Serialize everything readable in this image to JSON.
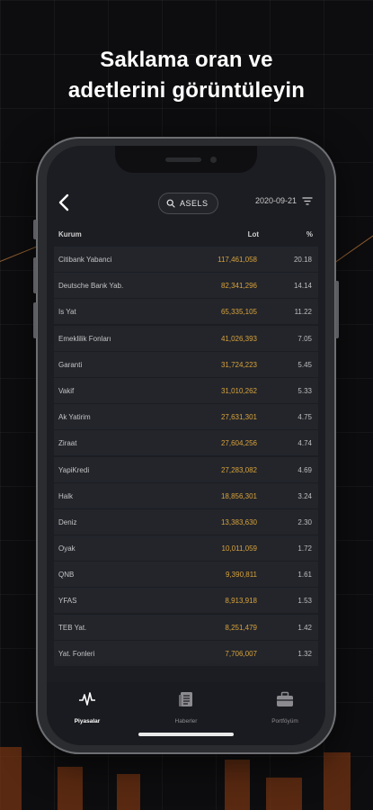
{
  "headline": {
    "line1": "Saklama oran ve",
    "line2": "adetlerini görüntüleyin"
  },
  "topbar": {
    "search_value": "ASELS",
    "date": "2020-09-21"
  },
  "table": {
    "headers": {
      "name": "Kurum",
      "lot": "Lot",
      "pct": "%"
    },
    "rows": [
      {
        "name": "Citibank Yabanci",
        "lot": "117,461,058",
        "pct": "20.18"
      },
      {
        "name": "Deutsche Bank Yab.",
        "lot": "82,341,296",
        "pct": "14.14"
      },
      {
        "name": "Is Yat",
        "lot": "65,335,105",
        "pct": "11.22"
      },
      {
        "name": "Emeklilik Fonları",
        "lot": "41,026,393",
        "pct": "7.05"
      },
      {
        "name": "Garanti",
        "lot": "31,724,223",
        "pct": "5.45"
      },
      {
        "name": "Vakif",
        "lot": "31,010,262",
        "pct": "5.33"
      },
      {
        "name": "Ak Yatirim",
        "lot": "27,631,301",
        "pct": "4.75"
      },
      {
        "name": "Ziraat",
        "lot": "27,604,256",
        "pct": "4.74"
      },
      {
        "name": "YapiKredi",
        "lot": "27,283,082",
        "pct": "4.69"
      },
      {
        "name": "Halk",
        "lot": "18,856,301",
        "pct": "3.24"
      },
      {
        "name": "Deniz",
        "lot": "13,383,630",
        "pct": "2.30"
      },
      {
        "name": "Oyak",
        "lot": "10,011,059",
        "pct": "1.72"
      },
      {
        "name": "QNB",
        "lot": "9,390,811",
        "pct": "1.61"
      },
      {
        "name": "YFAS",
        "lot": "8,913,918",
        "pct": "1.53"
      },
      {
        "name": "TEB Yat.",
        "lot": "8,251,479",
        "pct": "1.42"
      },
      {
        "name": "Yat. Fonleri",
        "lot": "7,706,007",
        "pct": "1.32"
      }
    ]
  },
  "tabbar": {
    "tabs": [
      {
        "label": "Piyasalar",
        "icon": "pulse-icon",
        "active": true
      },
      {
        "label": "Haberler",
        "icon": "newspaper-icon",
        "active": false
      },
      {
        "label": "Portföyüm",
        "icon": "briefcase-icon",
        "active": false
      }
    ]
  },
  "colors": {
    "accent": "#d8a23a",
    "background": "#1c1d22",
    "row": "#23252b"
  }
}
